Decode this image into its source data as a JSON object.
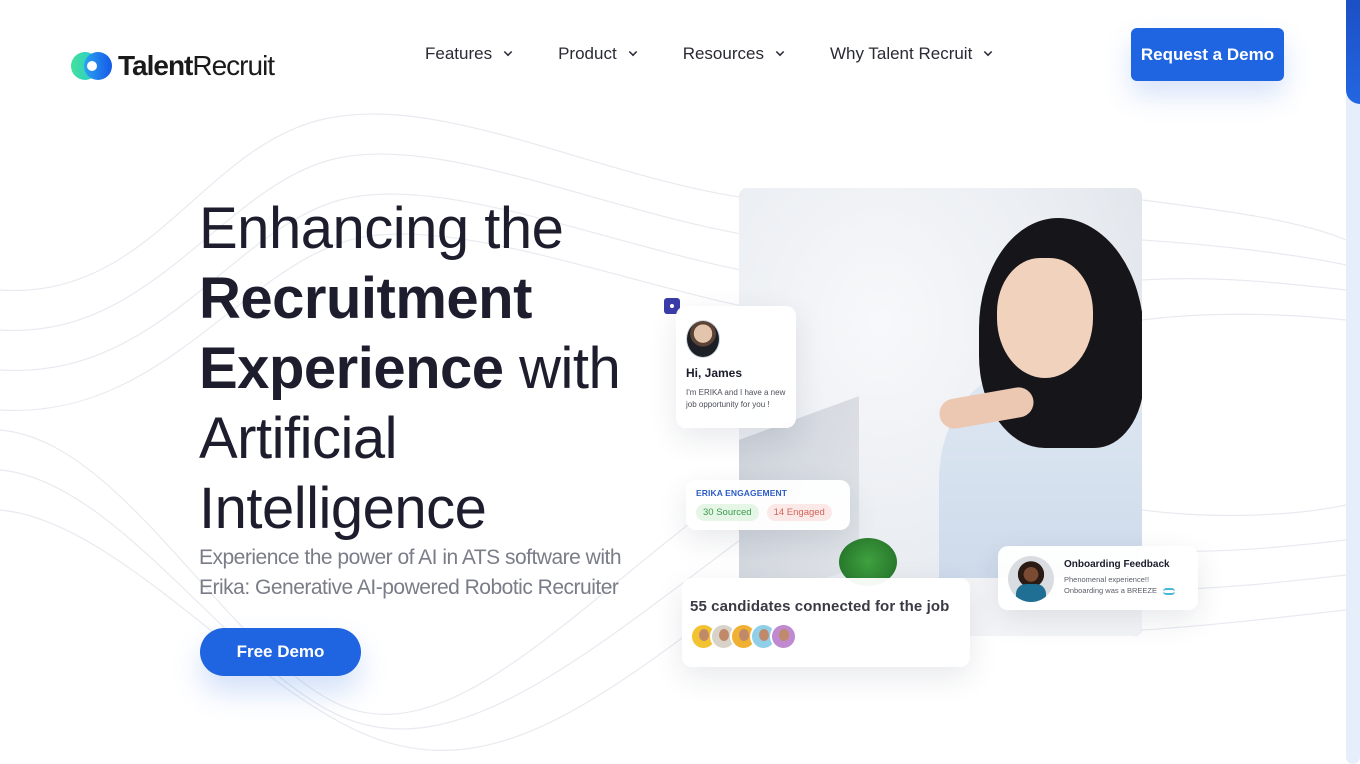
{
  "brand": {
    "name_bold": "Talent",
    "name_light": "Recruit",
    "colors": {
      "primary": "#1f64e0",
      "heading": "#1d1d2e",
      "subtext": "#7a7d88",
      "logo_green": "#3ee0a0",
      "logo_blue": "#1c6cf0"
    }
  },
  "nav": {
    "items": [
      {
        "label": "Features",
        "icon": "chevron-down-icon"
      },
      {
        "label": "Product",
        "icon": "chevron-down-icon"
      },
      {
        "label": "Resources",
        "icon": "chevron-down-icon"
      },
      {
        "label": "Why Talent Recruit",
        "icon": "chevron-down-icon"
      }
    ],
    "cta_label": "Request a Demo"
  },
  "hero": {
    "title_line1": "Enhancing the",
    "title_line2": "Recruitment",
    "title_line3_bold": "Experience",
    "title_line3_light": " with",
    "title_line4": "Artificial",
    "title_line5": "Intelligence",
    "subtitle": "Experience the power of AI in ATS software with Erika: Generative AI-powered Robotic Recruiter",
    "cta_label": "Free Demo"
  },
  "visual": {
    "greeting_card": {
      "greeting": "Hi, James",
      "message": "I'm ERIKA and I have a new job opportunity for you !"
    },
    "engagement_card": {
      "title": "ERIKA ENGAGEMENT",
      "sourced": "30 Sourced",
      "engaged": "14 Engaged"
    },
    "candidates_card": {
      "text": "55 candidates connected for the job",
      "avatar_colors": [
        "#f2c230",
        "#d9d2c8",
        "#f0b032",
        "#8fd0e8",
        "#c08ad0"
      ]
    },
    "feedback_card": {
      "title": "Onboarding Feedback",
      "line1": "Phenomenal experience!!",
      "line2": "Onboarding was a BREEZE"
    }
  }
}
